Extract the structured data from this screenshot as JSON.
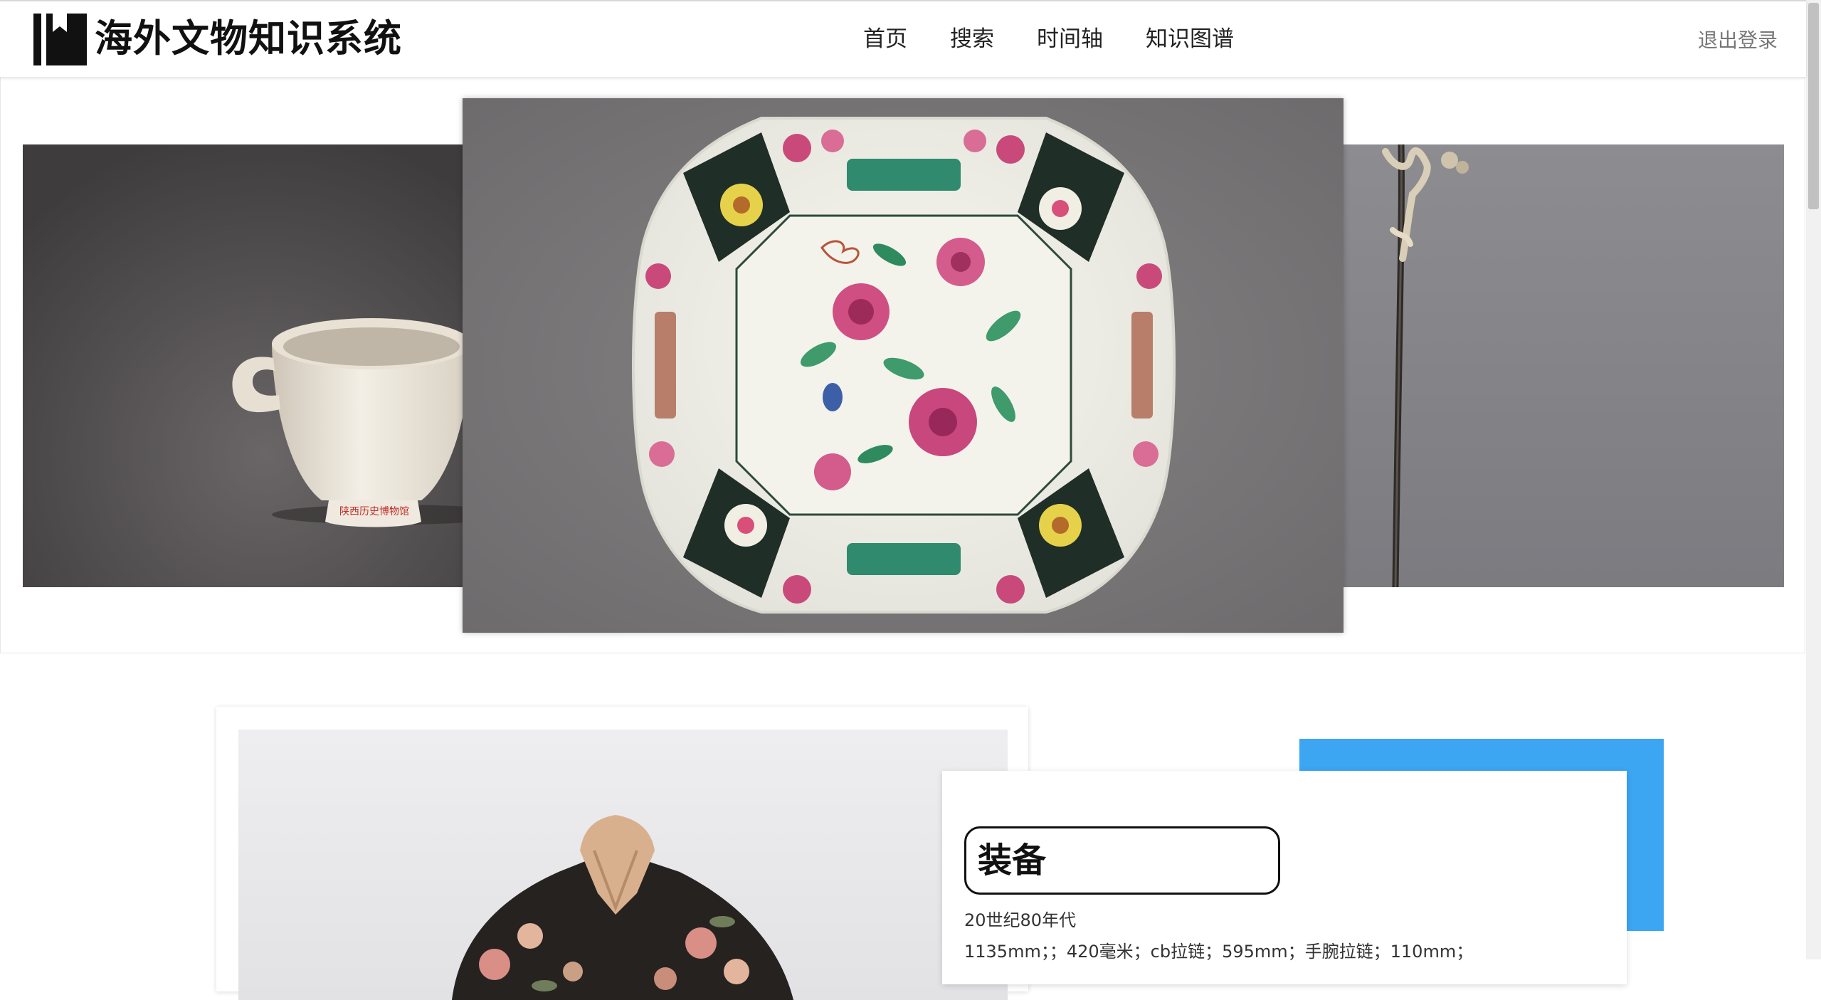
{
  "header": {
    "logo_icon": "library-book-icon",
    "site_title": "海外文物知识系统",
    "nav": [
      "首页",
      "搜索",
      "时间轴",
      "知识图谱"
    ],
    "logout": "退出登录"
  },
  "carousel": {
    "slides": [
      {
        "subject": "white-glazed-ceramic-cup"
      },
      {
        "subject": "famille-rose-porcelain-plate"
      },
      {
        "subject": "metal-hairpin"
      }
    ],
    "cup_foot_inscription": "陕西历史博物馆"
  },
  "artifact": {
    "title": "装备",
    "era": "20世纪80年代",
    "dimensions": "1135mm；；420毫米；cb拉链；595mm；手腕拉链；110mm；"
  },
  "colors": {
    "accent_blue": "#3ca6f3",
    "nav_text": "#222222",
    "logout_text": "#777777"
  }
}
